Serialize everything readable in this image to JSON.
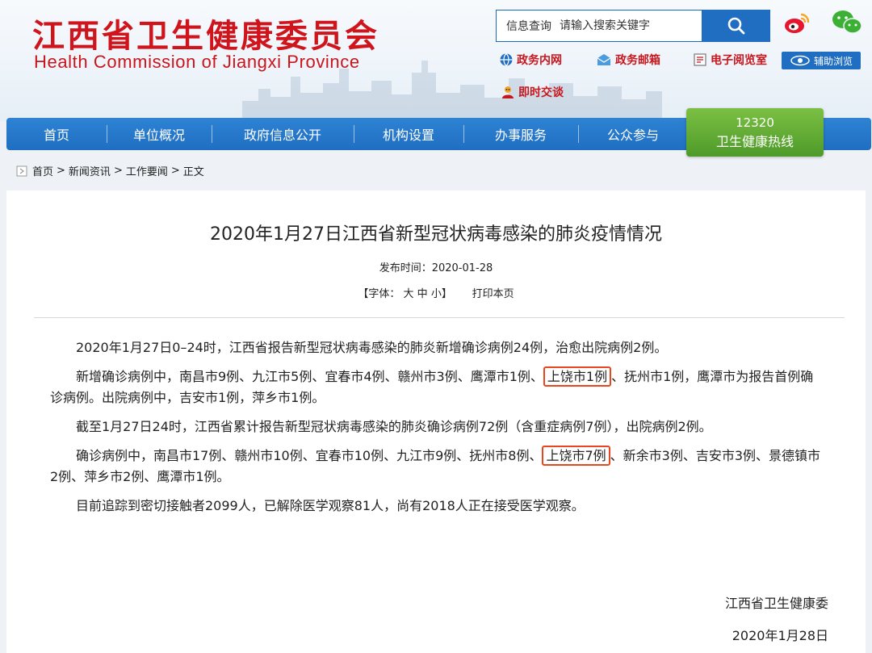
{
  "header": {
    "site_title": "江西省卫生健康委员会",
    "site_subtitle": "Health Commission of Jiangxi Province",
    "search_label": "信息查询",
    "search_placeholder": "请输入搜索关键字",
    "links": [
      {
        "label": "政务内网",
        "icon": "globe-icon"
      },
      {
        "label": "政务邮箱",
        "icon": "mail-icon"
      },
      {
        "label": "电子阅览室",
        "icon": "reader-icon"
      },
      {
        "label": "即时交谈",
        "icon": "chat-user-icon"
      }
    ],
    "assist_label": "辅助浏览",
    "colors": {
      "brand_red": "#d0141c",
      "nav_blue": "#1f6ec2",
      "hotline_green": "#5aa832"
    }
  },
  "nav": {
    "items": [
      "首页",
      "单位概况",
      "政府信息公开",
      "机构设置",
      "办事服务",
      "公众参与"
    ],
    "hotline_number": "12320",
    "hotline_label": "卫生健康热线"
  },
  "breadcrumb": [
    "首页",
    "新闻资讯",
    "工作要闻",
    "正文"
  ],
  "article": {
    "title": "2020年1月27日江西省新型冠状病毒感染的肺炎疫情情况",
    "publish_label": "发布时间：",
    "publish_date": "2020-01-28",
    "font_label": "【字体：",
    "font_large": "大",
    "font_medium": "中",
    "font_small": "小",
    "font_close": "】",
    "print_label": "打印本页",
    "p1": "2020年1月27日0–24时，江西省报告新型冠状病毒感染的肺炎新增确诊病例24例，治愈出院病例2例。",
    "p2_before": "新增确诊病例中，南昌市9例、九江市5例、宜春市4例、赣州市3例、鹰潭市1例、",
    "p2_highlight": "上饶市1例",
    "p2_after": "、抚州市1例，鹰潭市为报告首例确诊病例。出院病例中，吉安市1例，萍乡市1例。",
    "p3": "截至1月27日24时，江西省累计报告新型冠状病毒感染的肺炎确诊病例72例（含重症病例7例），出院病例2例。",
    "p4_before": "确诊病例中，南昌市17例、赣州市10例、宜春市10例、九江市9例、抚州市8例、",
    "p4_highlight": "上饶市7例",
    "p4_after": "、新余市3例、吉安市3例、景德镇市2例、萍乡市2例、鹰潭市1例。",
    "p5": "目前追踪到密切接触者2099人，已解除医学观察81人，尚有2018人正在接受医学观察。",
    "signature": "江西省卫生健康委",
    "sign_date": "2020年1月28日"
  }
}
